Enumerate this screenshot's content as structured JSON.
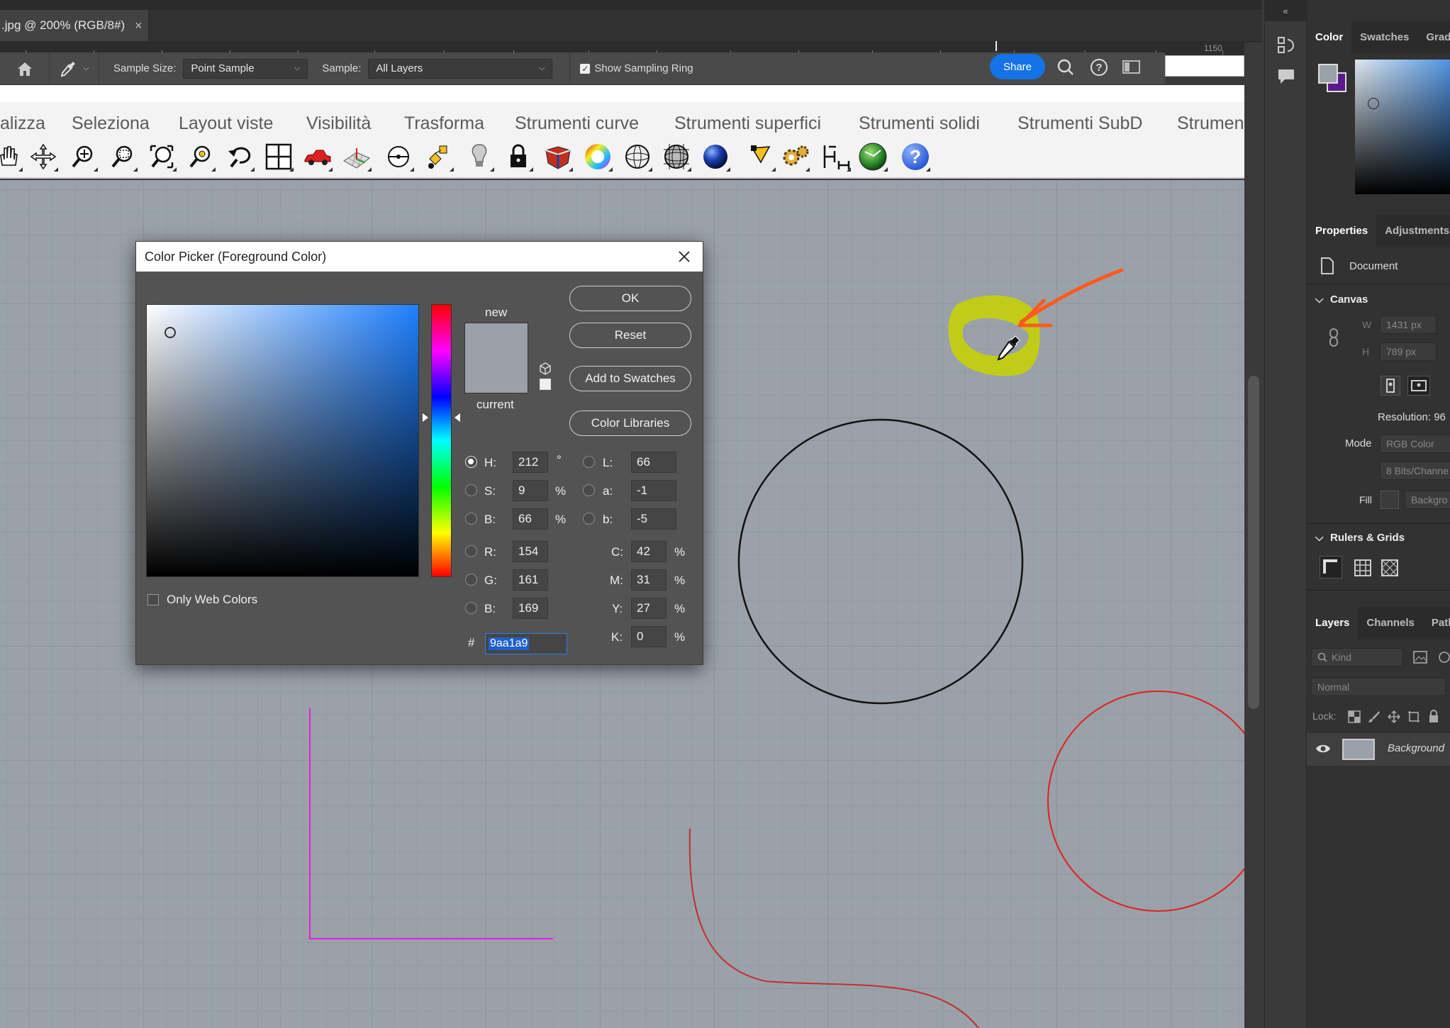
{
  "doc_tab": {
    "title": ".jpg @ 200% (RGB/8#)",
    "close": "×"
  },
  "ruler": {
    "ticks": [
      "1150"
    ]
  },
  "options_bar": {
    "sample_size_label": "Sample Size:",
    "sample_size_value": "Point Sample",
    "sample_label": "Sample:",
    "sample_value": "All Layers",
    "show_ring_label": "Show Sampling Ring",
    "show_ring_checked": true,
    "share_label": "Share"
  },
  "rhino_menu": [
    "alizza",
    "Seleziona",
    "Layout viste",
    "Visibilità",
    "Trasforma",
    "Strumenti curve",
    "Strumenti superfici",
    "Strumenti solidi",
    "Strumenti SubD",
    "Strumen"
  ],
  "rhino_tools": [
    "pan-hand-icon",
    "rotate-view-icon",
    "zoom-dynamic-icon",
    "zoom-window-icon",
    "zoom-extents-icon",
    "zoom-selected-icon",
    "undo-view-icon",
    "four-viewports-icon",
    "car-icon",
    "plane-grid-icon",
    "cplane-icon",
    "analyze-icon",
    "lightbulb-icon",
    "lock-icon",
    "shade-icon",
    "color-wheel-icon",
    "wireframe-sphere-icon",
    "ghosted-sphere-icon",
    "rendered-sphere-icon",
    "spotlight-icon",
    "settings-gear-icon",
    "dimension-icon",
    "render-globe-icon",
    "help-icon"
  ],
  "dialog": {
    "title": "Color Picker (Foreground Color)",
    "new_label": "new",
    "current_label": "current",
    "new_color": "#9aa1a9",
    "buttons": {
      "ok": "OK",
      "reset": "Reset",
      "add_swatches": "Add to Swatches",
      "libraries": "Color Libraries"
    },
    "only_web_colors": "Only Web Colors",
    "hsb": {
      "h_label": "H:",
      "h": "212",
      "h_unit": "°",
      "s_label": "S:",
      "s": "9",
      "s_unit": "%",
      "b_label": "B:",
      "b": "66",
      "b_unit": "%"
    },
    "rgb": {
      "r_label": "R:",
      "r": "154",
      "g_label": "G:",
      "g": "161",
      "b_label": "B:",
      "b": "169"
    },
    "lab": {
      "l_label": "L:",
      "l": "66",
      "a_label": "a:",
      "a": "-1",
      "b_label": "b:",
      "b": "-5"
    },
    "cmyk": {
      "c_label": "C:",
      "c": "42",
      "m_label": "M:",
      "m": "31",
      "y_label": "Y:",
      "y": "27",
      "k_label": "K:",
      "k": "0",
      "unit": "%"
    },
    "hex_label": "#",
    "hex": "9aa1a9"
  },
  "right_panel": {
    "color_tabs": [
      "Color",
      "Swatches",
      "Grad"
    ],
    "props_tabs": [
      "Properties",
      "Adjustments"
    ],
    "document_label": "Document",
    "canvas_section": "Canvas",
    "w_label": "W",
    "w_value": "1431 px",
    "h_label": "H",
    "h_value": "789 px",
    "resolution": "Resolution: 96",
    "mode_label": "Mode",
    "mode_value": "RGB Color",
    "bits_value": "8 Bits/Channe",
    "fill_label": "Fill",
    "fill_value": "Backgro",
    "rulers_section": "Rulers & Grids",
    "layers_tabs": [
      "Layers",
      "Channels",
      "Path"
    ],
    "kind_placeholder": "Kind",
    "blend_mode": "Normal",
    "lock_label": "Lock:",
    "layer_name": "Background"
  },
  "colors": {
    "canvas": "#9aa1a9",
    "accent": "#1473e6",
    "annotation": "#ff5a1f",
    "highlight": "#c8d400"
  }
}
